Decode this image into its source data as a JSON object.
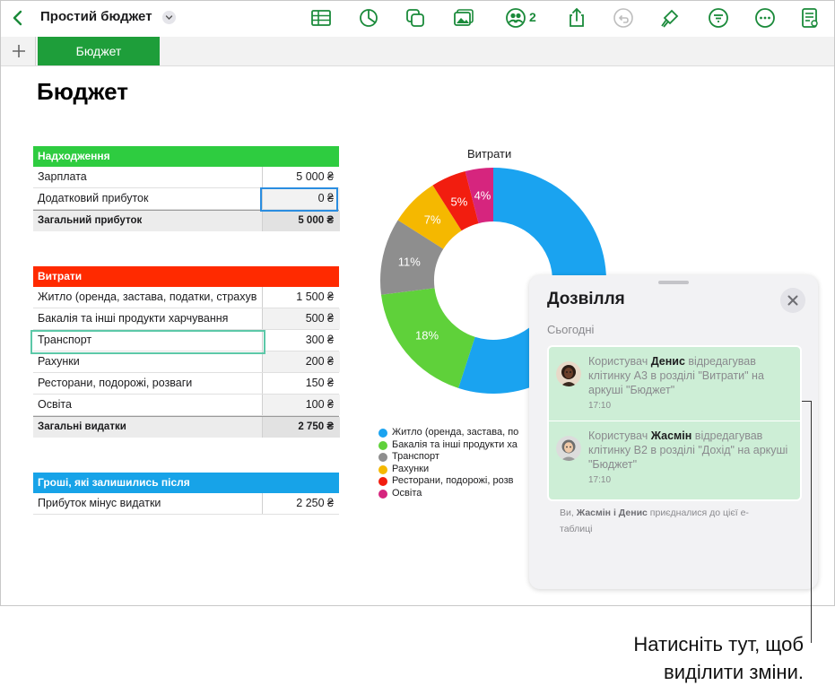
{
  "toolbar": {
    "doc_title": "Простий бюджет",
    "collab_count": "2",
    "accent": "#1a8a3a"
  },
  "tabs": [
    {
      "label": "Бюджет"
    }
  ],
  "sheet_title": "Бюджет",
  "income_table": {
    "header": "Надходження",
    "header_color": "#2ecc40",
    "rows": [
      {
        "label": "Зарплата",
        "value": "5 000 ₴"
      },
      {
        "label": "Додатковий прибуток",
        "value": "0 ₴"
      }
    ],
    "total": {
      "label": "Загальний прибуток",
      "value": "5 000 ₴"
    }
  },
  "expenses_table": {
    "header": "Витрати",
    "header_color": "#ff2a00",
    "rows": [
      {
        "label": "Житло (оренда, застава, податки, страхув",
        "value": "1 500 ₴"
      },
      {
        "label": "Бакалія та інші продукти харчування",
        "value": "500 ₴"
      },
      {
        "label": "Транспорт",
        "value": "300 ₴"
      },
      {
        "label": "Рахунки",
        "value": "200 ₴"
      },
      {
        "label": "Ресторани, подорожі, розваги",
        "value": "150 ₴"
      },
      {
        "label": "Освіта",
        "value": "100 ₴"
      }
    ],
    "total": {
      "label": "Загальні видатки",
      "value": "2 750 ₴"
    }
  },
  "remaining_table": {
    "header": "Гроші, які залишились після",
    "header_color": "#17a3e8",
    "rows": [
      {
        "label": "Прибуток мінус видатки",
        "value": "2 250 ₴"
      }
    ]
  },
  "chart_data": {
    "type": "pie",
    "donut": true,
    "title": "Витрати",
    "categories": [
      "Житло (оренда, застава, по",
      "Бакалія та інші продукти ха",
      "Транспорт",
      "Рахунки",
      "Ресторани, подорожі, розв",
      "Освіта"
    ],
    "values": [
      55,
      18,
      11,
      7,
      5,
      4
    ],
    "labels": [
      "",
      "18%",
      "11%",
      "7%",
      "5%",
      "4%"
    ],
    "colors": [
      "#1aa3f0",
      "#5fd13a",
      "#8e8e8e",
      "#f5b800",
      "#f21d0f",
      "#d6257e"
    ],
    "legend_position": "bottom"
  },
  "activity_panel": {
    "title": "Дозвілля",
    "section": "Сьогодні",
    "items": [
      {
        "prefix": "Користувач ",
        "user": "Денис",
        "text": " відредагував клітинку A3 в розділі \"Витрати\" на аркуші \"Бюджет\"",
        "time": "17:10"
      },
      {
        "prefix": "Користувач ",
        "user": "Жасмін",
        "text": " відредагував клітинку B2 в розділі \"Дохід\" на аркуші \"Бюджет\"",
        "time": "17:10"
      }
    ],
    "footer_prefix": "Ви, ",
    "footer_names": "Жасмін і Денис",
    "footer_suffix": " приєдналися до цієї е-таблиці"
  },
  "callout": {
    "line1": "Натисніть тут, щоб",
    "line2": "виділити зміни."
  }
}
